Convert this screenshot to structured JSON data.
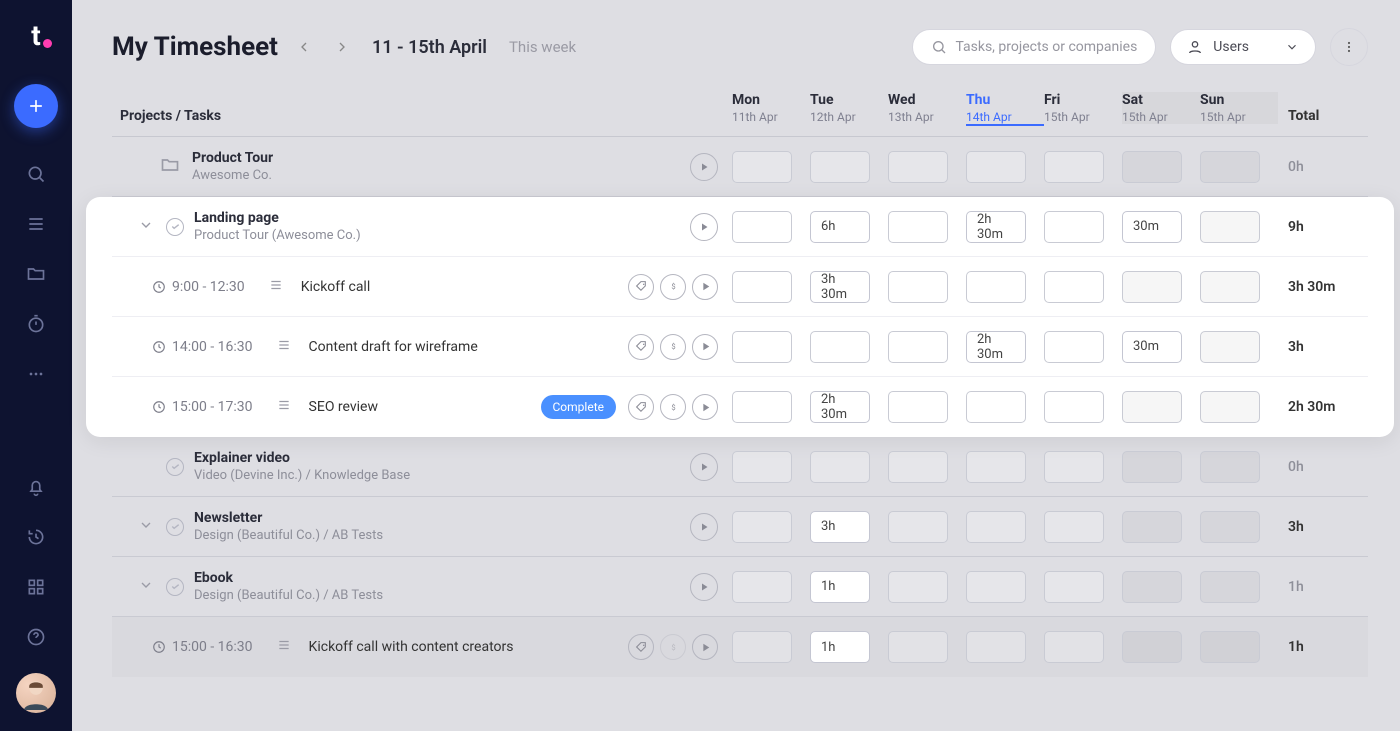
{
  "header": {
    "title": "My Timesheet",
    "date_range": "11 - 15th April",
    "this_week": "This week",
    "search_placeholder": "Tasks, projects or companies",
    "users_label": "Users"
  },
  "columns": {
    "projects_tasks": "Projects / Tasks",
    "total": "Total",
    "days": [
      {
        "d": "Mon",
        "date": "11th Apr",
        "today": false,
        "weekend": false
      },
      {
        "d": "Tue",
        "date": "12th Apr",
        "today": false,
        "weekend": false
      },
      {
        "d": "Wed",
        "date": "13th Apr",
        "today": false,
        "weekend": false
      },
      {
        "d": "Thu",
        "date": "14th Apr",
        "today": true,
        "weekend": false
      },
      {
        "d": "Fri",
        "date": "15th Apr",
        "today": false,
        "weekend": false
      },
      {
        "d": "Sat",
        "date": "15th Apr",
        "today": false,
        "weekend": true
      },
      {
        "d": "Sun",
        "date": "15th Apr",
        "today": false,
        "weekend": true
      }
    ]
  },
  "rows": [
    {
      "kind": "project",
      "name": "Product Tour",
      "subtitle": "Awesome Co.",
      "cells": [
        "",
        "",
        "",
        "",
        "",
        "",
        ""
      ],
      "total": "0h",
      "dim_total": true,
      "show_play": true
    },
    {
      "kind": "group-open",
      "highlight": true
    },
    {
      "kind": "task",
      "name": "Landing page",
      "subtitle": "Product Tour (Awesome Co.)",
      "expand": true,
      "cells": [
        "",
        "6h",
        "",
        "2h 30m",
        "",
        "30m",
        ""
      ],
      "total": "9h",
      "dim_total": false,
      "show_play": true
    },
    {
      "kind": "subtask",
      "time": "9:00 - 12:30",
      "name": "Kickoff call",
      "actions": {
        "tag": true,
        "bill": true,
        "play": true
      },
      "cells": [
        "",
        "3h 30m",
        "",
        "",
        "",
        "",
        ""
      ],
      "total": "3h 30m"
    },
    {
      "kind": "subtask",
      "time": "14:00 - 16:30",
      "name": "Content draft for wireframe",
      "actions": {
        "tag": true,
        "bill": true,
        "play": true
      },
      "cells": [
        "",
        "",
        "",
        "2h 30m",
        "",
        "30m",
        ""
      ],
      "total": "3h"
    },
    {
      "kind": "subtask",
      "time": "15:00 - 17:30",
      "name": "SEO review",
      "complete": true,
      "complete_label": "Complete",
      "actions": {
        "tag": true,
        "bill": true,
        "play": true
      },
      "cells": [
        "",
        "2h 30m",
        "",
        "",
        "",
        "",
        ""
      ],
      "total": "2h 30m"
    },
    {
      "kind": "group-close"
    },
    {
      "kind": "task",
      "name": "Explainer video",
      "subtitle": "Video (Devine Inc.)   /   Knowledge Base",
      "expand": false,
      "cells": [
        "",
        "",
        "",
        "",
        "",
        "",
        ""
      ],
      "total": "0h",
      "dim_total": true,
      "show_play": true
    },
    {
      "kind": "task",
      "name": "Newsletter",
      "subtitle": "Design  (Beautiful Co.)   /   AB Tests",
      "expand": true,
      "cells": [
        "",
        "3h",
        "",
        "",
        "",
        "",
        ""
      ],
      "total": "3h",
      "dim_total": false,
      "show_play": true
    },
    {
      "kind": "task",
      "name": "Ebook",
      "subtitle": "Design  (Beautiful Co.)   /   AB Tests",
      "expand": true,
      "cells": [
        "",
        "1h",
        "",
        "",
        "",
        "",
        ""
      ],
      "total": "1h",
      "dim_total": true,
      "show_play": true
    },
    {
      "kind": "subtask",
      "dim": true,
      "time": "15:00 - 16:30",
      "name": "Kickoff call with content creators",
      "actions": {
        "tag": true,
        "bill_disabled": true,
        "play": true
      },
      "cells": [
        "",
        "1h",
        "",
        "",
        "",
        "",
        ""
      ],
      "total": "1h"
    }
  ]
}
